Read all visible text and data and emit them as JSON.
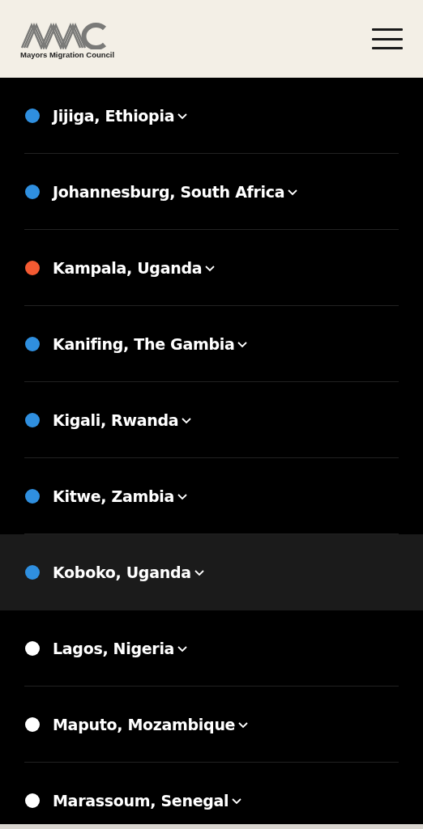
{
  "header": {
    "logo_caption": "Mayors Migration Council"
  },
  "cities": [
    {
      "name": "Jijiga, Ethiopia",
      "color": "#2f8fdf",
      "selected": false
    },
    {
      "name": "Johannesburg, South Africa",
      "color": "#2f8fdf",
      "selected": false
    },
    {
      "name": "Kampala, Uganda",
      "color": "#f45a32",
      "selected": false
    },
    {
      "name": "Kanifing, The Gambia",
      "color": "#2f8fdf",
      "selected": false
    },
    {
      "name": "Kigali, Rwanda",
      "color": "#2f8fdf",
      "selected": false
    },
    {
      "name": "Kitwe, Zambia",
      "color": "#2f8fdf",
      "selected": false
    },
    {
      "name": "Koboko, Uganda",
      "color": "#2f8fdf",
      "selected": true
    },
    {
      "name": "Lagos, Nigeria",
      "color": "#ffffff",
      "selected": false
    },
    {
      "name": "Maputo, Mozambique",
      "color": "#ffffff",
      "selected": false
    },
    {
      "name": "Marassoum, Senegal",
      "color": "#ffffff",
      "selected": false
    }
  ]
}
